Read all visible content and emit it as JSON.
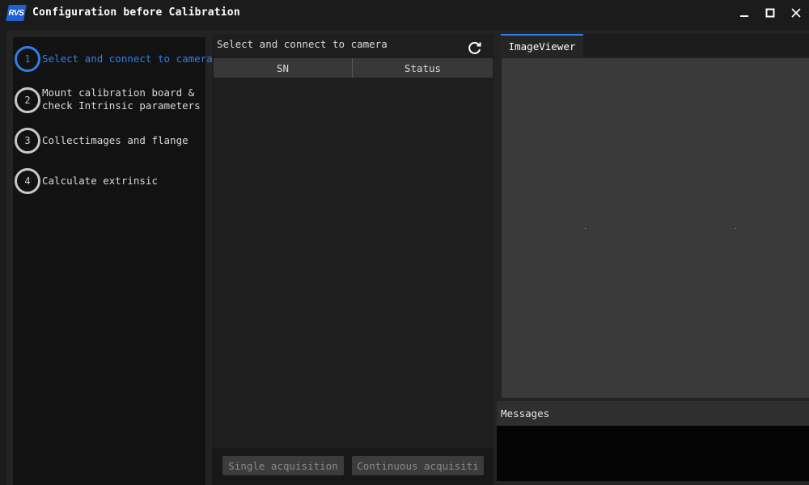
{
  "window": {
    "logo_text": "RVS",
    "title": "Configuration before Calibration",
    "minimize_icon": "minimize-icon",
    "maximize_icon": "maximize-icon",
    "close_icon": "close-icon"
  },
  "steps": [
    {
      "number": "1",
      "label": "Select and connect to camera",
      "active": true
    },
    {
      "number": "2",
      "label": "Mount calibration board &\ncheck Intrinsic parameters",
      "active": false
    },
    {
      "number": "3",
      "label": "Collectimages and flange",
      "active": false
    },
    {
      "number": "4",
      "label": "Calculate extrinsic",
      "active": false
    }
  ],
  "camera_panel": {
    "title": "Select and connect to camera",
    "refresh_icon": "refresh-icon",
    "columns": [
      "SN",
      "Status"
    ],
    "rows": [],
    "single_button": "Single acquisition",
    "continuous_button": "Continuous acquisiti"
  },
  "viewer": {
    "tab_label": "ImageViewer"
  },
  "messages": {
    "title": "Messages"
  },
  "colors": {
    "accent": "#2f7fe8",
    "background": "#1b1b1b",
    "viewer": "#3a3a3a"
  }
}
